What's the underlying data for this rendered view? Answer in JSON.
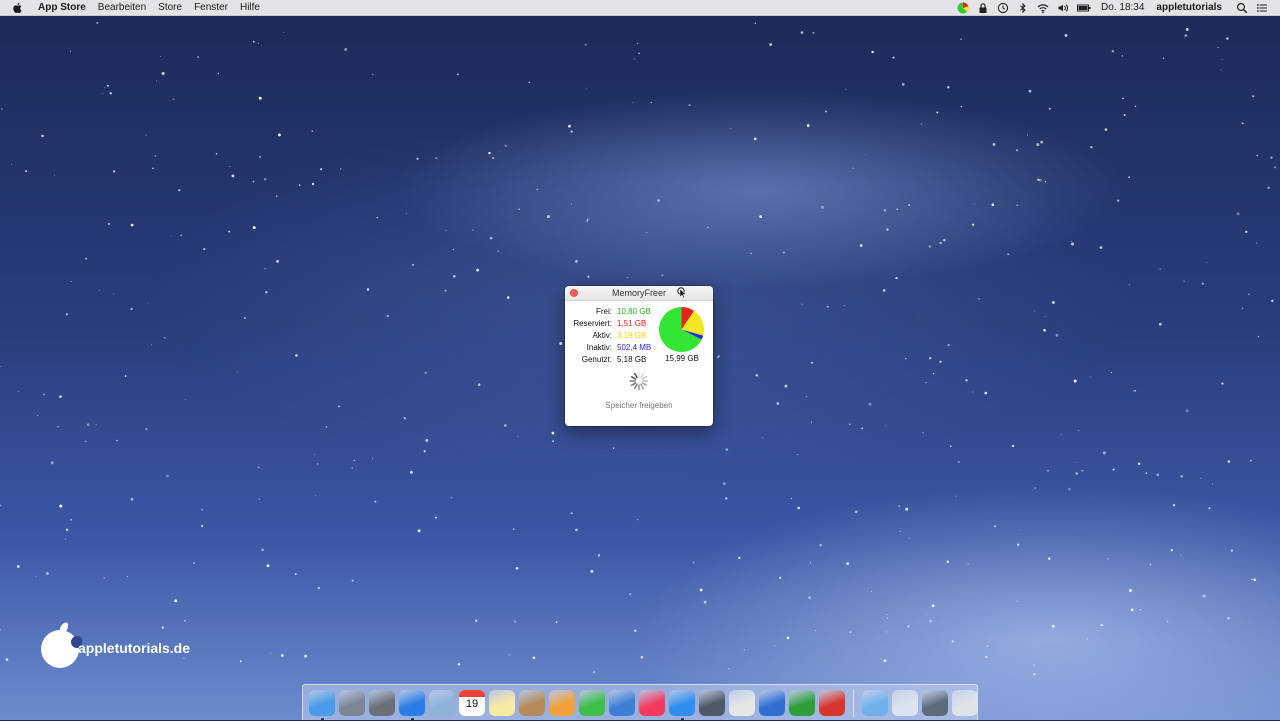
{
  "menubar": {
    "app_name": "App Store",
    "items": [
      "Bearbeiten",
      "Store",
      "Fenster",
      "Hilfe"
    ],
    "clock": "Do. 18:34",
    "user": "appletutorials"
  },
  "watermark": {
    "text": "appletutorials.de"
  },
  "window": {
    "title": "MemoryFreer",
    "stats": [
      {
        "label": "Frei:",
        "value": "10,80 GB",
        "color": "#22b422"
      },
      {
        "label": "Reserviert:",
        "value": "1,51 GB",
        "color": "#e0202a"
      },
      {
        "label": "Aktiv:",
        "value": "3,19 GB",
        "color": "#e8d60a"
      },
      {
        "label": "Inaktiv:",
        "value": "502,4 MB",
        "color": "#2a2ad8"
      },
      {
        "label": "Genutzt:",
        "value": "5,18 GB",
        "color": "#111111"
      }
    ],
    "total": "15,99 GB",
    "button_label": "Speicher freigeben"
  },
  "chart_data": {
    "type": "pie",
    "categories": [
      "Frei",
      "Reserviert",
      "Aktiv",
      "Inaktiv"
    ],
    "values": [
      10.8,
      1.51,
      3.19,
      0.49
    ],
    "colors": [
      "#33e633",
      "#e8231e",
      "#f4e623",
      "#2d2de0"
    ]
  },
  "dock": {
    "items": [
      {
        "name": "finder",
        "color": "#4a9be8",
        "running": true
      },
      {
        "name": "launchpad",
        "color": "#7c8595",
        "running": false
      },
      {
        "name": "system-preferences",
        "color": "#6b6f76",
        "running": false
      },
      {
        "name": "safari",
        "color": "#2b7de6",
        "running": true
      },
      {
        "name": "preview",
        "color": "#8fb3d8",
        "running": false
      },
      {
        "name": "calendar",
        "color": "#f2f2f2",
        "running": false
      },
      {
        "name": "notes",
        "color": "#f7e9a6",
        "running": false
      },
      {
        "name": "contacts",
        "color": "#b58b58",
        "running": false
      },
      {
        "name": "pages",
        "color": "#f2a13b",
        "running": false
      },
      {
        "name": "numbers",
        "color": "#3fbf4a",
        "running": false
      },
      {
        "name": "keynote",
        "color": "#3d7fd4",
        "running": false
      },
      {
        "name": "itunes",
        "color": "#f23a5f",
        "running": false
      },
      {
        "name": "app-store",
        "color": "#2f8ff0",
        "running": true
      },
      {
        "name": "photo-booth",
        "color": "#4e5866",
        "running": false
      },
      {
        "name": "image-capture",
        "color": "#e6e6e6",
        "running": false
      },
      {
        "name": "word",
        "color": "#2e6fd1",
        "running": false
      },
      {
        "name": "excel",
        "color": "#2f9e3a",
        "running": false
      },
      {
        "name": "powerpoint",
        "color": "#d9342b",
        "running": false
      }
    ],
    "stack_items": [
      {
        "name": "applications-folder",
        "color": "#6fb0ec"
      },
      {
        "name": "documents-folder",
        "color": "#d9e4ee"
      },
      {
        "name": "downloads-folder",
        "color": "#5c6a7c"
      },
      {
        "name": "trash",
        "color": "#dfe3e8"
      }
    ],
    "calendar_day": "19"
  }
}
